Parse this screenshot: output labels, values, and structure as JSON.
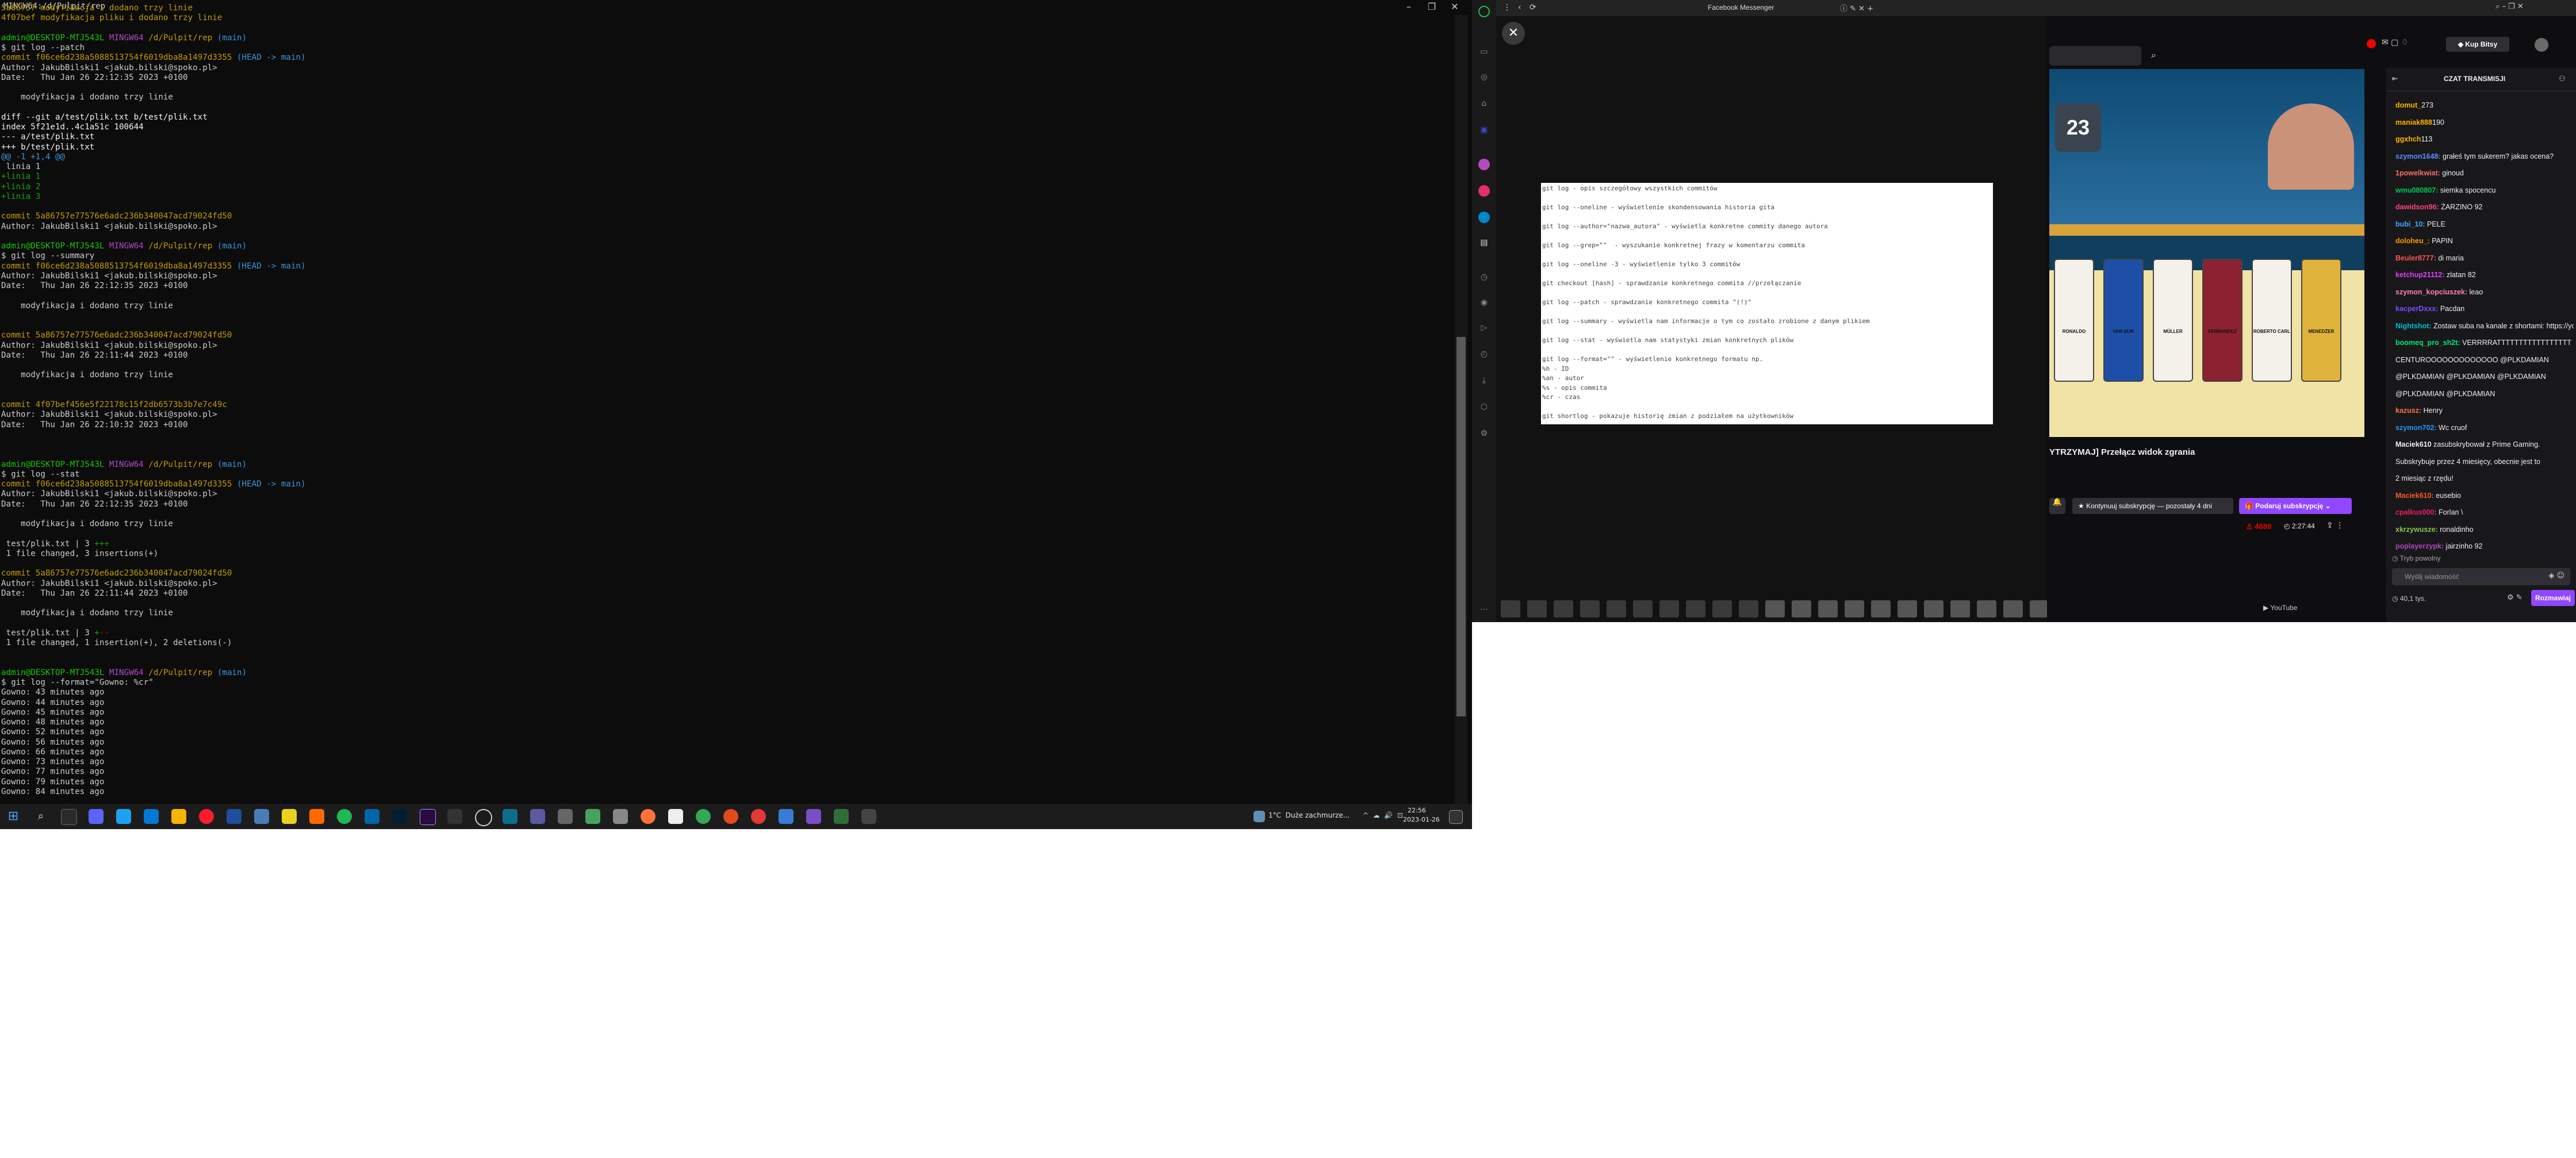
{
  "terminal": {
    "title": "MINGW64:/d/Pulpit/rep",
    "lines": [
      [
        [
          "5a86757 modyfikacja i dodano trzy linie",
          "c-yellow"
        ]
      ],
      [
        [
          "4f07bef modyfikacja pliku i dodano trzy linie",
          "c-yellow"
        ]
      ],
      [],
      [
        [
          "admin@DESKTOP-MTJ543L ",
          "c-lgreen"
        ],
        [
          "MINGW64 ",
          "c-mag"
        ],
        [
          "/d/Pulpit/rep ",
          "c-yellow"
        ],
        [
          "(main)",
          "c-cyan"
        ]
      ],
      [
        [
          "$ git log --patch",
          ""
        ]
      ],
      [
        [
          "commit f06ce6d238a5088513754f6019dba8a1497d3355 ",
          "c-yellow"
        ],
        [
          "(HEAD -> main)",
          "c-cyan"
        ]
      ],
      [
        [
          "Author: JakubBilski1 <jakub.bilski@spoko.pl>",
          ""
        ]
      ],
      [
        [
          "Date:   Thu Jan 26 22:12:35 2023 +0100",
          ""
        ]
      ],
      [],
      [
        [
          "    modyfikacja i dodano trzy linie",
          ""
        ]
      ],
      [],
      [
        [
          "diff --git a/test/plik.txt b/test/plik.txt",
          "c-white"
        ]
      ],
      [
        [
          "index 5f21e1d..4c1a51c 100644",
          "c-white"
        ]
      ],
      [
        [
          "--- a/test/plik.txt",
          "c-white"
        ]
      ],
      [
        [
          "+++ b/test/plik.txt",
          "c-white"
        ]
      ],
      [
        [
          "@@ -1 +1,4 @@",
          "c-cyan"
        ]
      ],
      [
        [
          " linia 1",
          ""
        ]
      ],
      [
        [
          "+linia 1",
          "c-green"
        ]
      ],
      [
        [
          "+linia 2",
          "c-green"
        ]
      ],
      [
        [
          "+linia 3",
          "c-green"
        ]
      ],
      [],
      [
        [
          "commit 5a86757e77576e6adc236b340047acd79024fd50",
          "c-yellow"
        ]
      ],
      [
        [
          "Author: JakubBilski1 <jakub.bilski@spoko.pl>",
          ""
        ]
      ],
      [],
      [
        [
          "admin@DESKTOP-MTJ543L ",
          "c-lgreen"
        ],
        [
          "MINGW64 ",
          "c-mag"
        ],
        [
          "/d/Pulpit/rep ",
          "c-yellow"
        ],
        [
          "(main)",
          "c-cyan"
        ]
      ],
      [
        [
          "$ git log --summary",
          ""
        ]
      ],
      [
        [
          "commit f06ce6d238a5088513754f6019dba8a1497d3355 ",
          "c-yellow"
        ],
        [
          "(HEAD -> main)",
          "c-cyan"
        ]
      ],
      [
        [
          "Author: JakubBilski1 <jakub.bilski@spoko.pl>",
          ""
        ]
      ],
      [
        [
          "Date:   Thu Jan 26 22:12:35 2023 +0100",
          ""
        ]
      ],
      [],
      [
        [
          "    modyfikacja i dodano trzy linie",
          ""
        ]
      ],
      [],
      [],
      [
        [
          "commit 5a86757e77576e6adc236b340047acd79024fd50",
          "c-yellow"
        ]
      ],
      [
        [
          "Author: JakubBilski1 <jakub.bilski@spoko.pl>",
          ""
        ]
      ],
      [
        [
          "Date:   Thu Jan 26 22:11:44 2023 +0100",
          ""
        ]
      ],
      [],
      [
        [
          "    modyfikacja i dodano trzy linie",
          ""
        ]
      ],
      [],
      [],
      [
        [
          "commit 4f07bef456e5f22178c15f2db6573b3b7e7c49c",
          "c-yellow"
        ]
      ],
      [
        [
          "Author: JakubBilski1 <jakub.bilski@spoko.pl>",
          ""
        ]
      ],
      [
        [
          "Date:   Thu Jan 26 22:10:32 2023 +0100",
          ""
        ]
      ],
      [],
      [],
      [],
      [
        [
          "admin@DESKTOP-MTJ543L ",
          "c-lgreen"
        ],
        [
          "MINGW64 ",
          "c-mag"
        ],
        [
          "/d/Pulpit/rep ",
          "c-yellow"
        ],
        [
          "(main)",
          "c-cyan"
        ]
      ],
      [
        [
          "$ git log --stat",
          ""
        ]
      ],
      [
        [
          "commit f06ce6d238a5088513754f6019dba8a1497d3355 ",
          "c-yellow"
        ],
        [
          "(HEAD -> main)",
          "c-cyan"
        ]
      ],
      [
        [
          "Author: JakubBilski1 <jakub.bilski@spoko.pl>",
          ""
        ]
      ],
      [
        [
          "Date:   Thu Jan 26 22:12:35 2023 +0100",
          ""
        ]
      ],
      [],
      [
        [
          "    modyfikacja i dodano trzy linie",
          ""
        ]
      ],
      [],
      [
        [
          " test/plik.txt | 3 ",
          ""
        ],
        [
          "+++",
          "c-green"
        ]
      ],
      [
        [
          " 1 file changed, 3 insertions(+)",
          ""
        ]
      ],
      [],
      [
        [
          "commit 5a86757e77576e6adc236b340047acd79024fd50",
          "c-yellow"
        ]
      ],
      [
        [
          "Author: JakubBilski1 <jakub.bilski@spoko.pl>",
          ""
        ]
      ],
      [
        [
          "Date:   Thu Jan 26 22:11:44 2023 +0100",
          ""
        ]
      ],
      [],
      [
        [
          "    modyfikacja i dodano trzy linie",
          ""
        ]
      ],
      [],
      [
        [
          " test/plik.txt | 3 ",
          ""
        ],
        [
          "+",
          "c-green"
        ],
        [
          "--",
          "c-red"
        ]
      ],
      [
        [
          " 1 file changed, 1 insertion(+), 2 deletions(-)",
          ""
        ]
      ],
      [],
      [],
      [
        [
          "admin@DESKTOP-MTJ543L ",
          "c-lgreen"
        ],
        [
          "MINGW64 ",
          "c-mag"
        ],
        [
          "/d/Pulpit/rep ",
          "c-yellow"
        ],
        [
          "(main)",
          "c-cyan"
        ]
      ],
      [
        [
          "$ git log --format=\"Gowno: %cr\"",
          ""
        ]
      ],
      [
        [
          "Gowno: 43 minutes ago",
          ""
        ]
      ],
      [
        [
          "Gowno: 44 minutes ago",
          ""
        ]
      ],
      [
        [
          "Gowno: 45 minutes ago",
          ""
        ]
      ],
      [
        [
          "Gowno: 48 minutes ago",
          ""
        ]
      ],
      [
        [
          "Gowno: 52 minutes ago",
          ""
        ]
      ],
      [
        [
          "Gowno: 56 minutes ago",
          ""
        ]
      ],
      [
        [
          "Gowno: 66 minutes ago",
          ""
        ]
      ],
      [
        [
          "Gowno: 73 minutes ago",
          ""
        ]
      ],
      [
        [
          "Gowno: 77 minutes ago",
          ""
        ]
      ],
      [
        [
          "Gowno: 79 minutes ago",
          ""
        ]
      ],
      [
        [
          "Gowno: 84 minutes ago",
          ""
        ]
      ]
    ]
  },
  "taskbar": {
    "weather": "1°C  Duże zachmurze...",
    "time": "22:56",
    "date": "2023-01-26"
  },
  "browser": {
    "tab_title": "Facebook Messenger",
    "viewer_close": "✕",
    "doc_lines": [
      "git log - opis szczegółowy wszystkich commitów",
      "",
      "git log --oneline - wyświetlenie skondensowania historia gita",
      "",
      "git log --author=\"nazwa_autora\" - wyświetla konkretne commity danego autora",
      "",
      "git log --grep=\"\"  - wyszukanie konkretnej frazy w komentarzu commita",
      "",
      "git log --oneline -3 - wyświetlenie tylko 3 commitów",
      "",
      "git checkout [hash] - sprawdzanie konkretnego commita //przełączanie",
      "",
      "git log --patch - sprawdzanie konkretnego commita \"(!)\"",
      "",
      "git log --summary - wyświetla nam informacje o tym co zostało zrobione z danym plikiem",
      "",
      "git log --stat - wyświetla nam statystyki zmian konkretnych plików",
      "",
      "git log --format=\"\" - wyświetlenie konkretnego formatu np.",
      "%h - ID",
      "%an - autor",
      "%s - opis commita",
      "%cr - czas",
      "",
      "git shortlog - pokazuje historię zmian z podziałem na użytkowników"
    ]
  },
  "twitch": {
    "stream_title": "YTRZYMAJ] Przełącz widok zgrania",
    "subscribe_notice": "Kontynuuj subskrypcję — pozostały 4 dni",
    "subscribe_button": "Podaruj subskrypcję",
    "viewers": "4689",
    "uptime": "2:27:44",
    "buy_bits": "Kup Bitsy",
    "chat_header": "CZAT TRANSMISJI",
    "youtube": "YouTube",
    "rating": "23",
    "chat_lines": [
      {
        "user": "domut_",
        "text": "273"
      },
      {
        "user": "maniak888",
        "text": "190"
      },
      {
        "user": "ggxhch",
        "text": "113"
      },
      {
        "user": "szymon1648:",
        "text": " grałeś tym sukerem? jakas ocena?"
      },
      {
        "user": "1powelkwiat:",
        "text": " ginoud"
      },
      {
        "user": "wmu080807:",
        "text": " siemka spocencu"
      },
      {
        "user": "dawidson96:",
        "text": " ŻARZINO 92"
      },
      {
        "user": "bubi_10:",
        "text": " PELE"
      },
      {
        "user": "doloheu_:",
        "text": " PAPIN"
      },
      {
        "user": "Beuler8777:",
        "text": " di maria"
      },
      {
        "user": "ketchup21112:",
        "text": " zlatan 82"
      },
      {
        "user": "szymon_kopciuszek:",
        "text": " leao"
      },
      {
        "user": "kacperDxxx:",
        "text": " Pacdan"
      },
      {
        "user": "Nightshot:",
        "text": " Zostaw suba na kanale z shortami: https://youtube.com/c/PLKDShorty"
      },
      {
        "user": "boomeq_pro_sh2t:",
        "text": " VERRRRATTTTTTTTTTTTTTTTT"
      },
      {
        "user": "",
        "text": "CENTUROOOOOOOOOOOOO @PLKDAMIAN"
      },
      {
        "user": "",
        "text": "@PLKDAMIAN @PLKDAMIAN @PLKDAMIAN"
      },
      {
        "user": "",
        "text": "@PLKDAMIAN @PLKDAMIAN"
      },
      {
        "user": "kazusz:",
        "text": " Henry"
      },
      {
        "user": "szymon702:",
        "text": " Wc cruof"
      },
      {
        "user": "Maciek610",
        "text": " zasubskrybował z Prime Gaming."
      },
      {
        "user": "",
        "text": "Subskrybuje przez 4 miesięcy, obecnie jest to"
      },
      {
        "user": "",
        "text": "2 miesiąc z rzędu!"
      },
      {
        "user": "Maciek610:",
        "text": " eusebio"
      },
      {
        "user": "cpalkus000:",
        "text": " Forlan \\"
      },
      {
        "user": "xkrzywusze:",
        "text": " ronaldinho"
      },
      {
        "user": "poplayerzypk:",
        "text": " jairzinho 92"
      }
    ],
    "chat_mode": "Tryb powolny",
    "chat_input_placeholder": "Wyślij wiadomość",
    "chat_points": "40,1 tys.",
    "chat_send": "Rozmawiaj",
    "cards": [
      "RONALDO",
      "VAN DIJK",
      "MÜLLER",
      "FERNANDEZ",
      "ROBERTO CARL",
      "MENEDŻER"
    ]
  },
  "colors": {
    "accent": "#9147ff",
    "link": "#4aa3ff",
    "subscribe_red": "#eb0400"
  }
}
